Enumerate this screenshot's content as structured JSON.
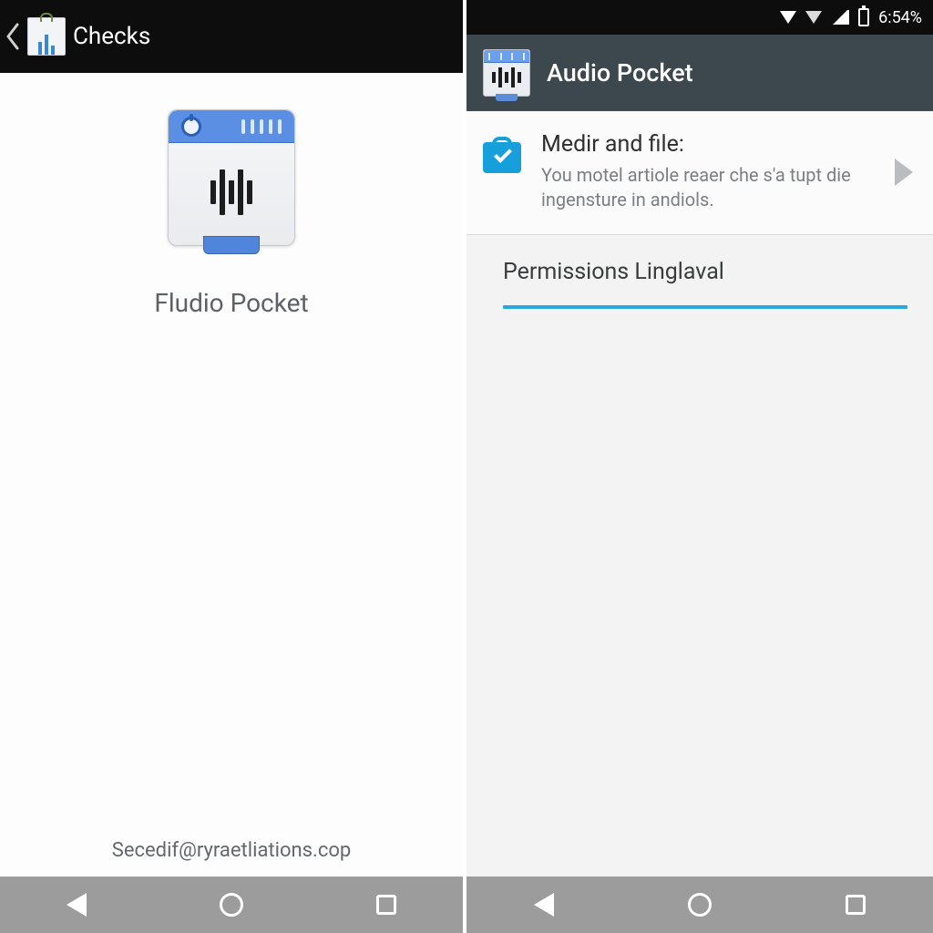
{
  "left": {
    "appbar_title": "Checks",
    "app_name": "Fludio Pocket",
    "footer_text": "Secedif@ryraetliations.cop"
  },
  "right": {
    "status": {
      "time": "6:54%"
    },
    "appbar_title": "Audio Pocket",
    "card": {
      "title": "Medir and file:",
      "desc": "You motel artiole reaer che s'a tupt die ingensture in andiols."
    },
    "section_title": "Permissions Linglaval"
  }
}
